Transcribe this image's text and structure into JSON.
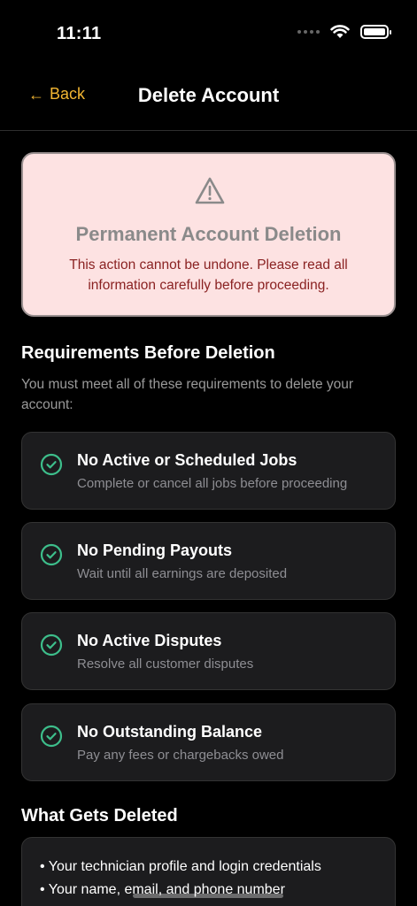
{
  "status_bar": {
    "time": "11:11"
  },
  "nav": {
    "back_label": "Back",
    "title": "Delete Account",
    "accent_color": "#F2B632"
  },
  "warning": {
    "title": "Permanent Account Deletion",
    "text": "This action cannot be undone. Please read all information carefully before proceeding.",
    "icon": "warning-triangle-icon"
  },
  "requirements": {
    "title": "Requirements Before Deletion",
    "subtitle": "You must meet all of these requirements to delete your account:",
    "items": [
      {
        "title": "No Active or Scheduled Jobs",
        "desc": "Complete or cancel all jobs before proceeding",
        "icon": "check-circle-icon"
      },
      {
        "title": "No Pending Payouts",
        "desc": "Wait until all earnings are deposited",
        "icon": "check-circle-icon"
      },
      {
        "title": "No Active Disputes",
        "desc": "Resolve all customer disputes",
        "icon": "check-circle-icon"
      },
      {
        "title": "No Outstanding Balance",
        "desc": "Pay any fees or chargebacks owed",
        "icon": "check-circle-icon"
      }
    ]
  },
  "deleted": {
    "title": "What Gets Deleted",
    "items": [
      "Your technician profile and login credentials",
      "Your name, email, and phone number"
    ]
  },
  "colors": {
    "check": "#3DBE8B",
    "warning_bg": "#FDE2E2",
    "warning_text": "#8a2222"
  }
}
